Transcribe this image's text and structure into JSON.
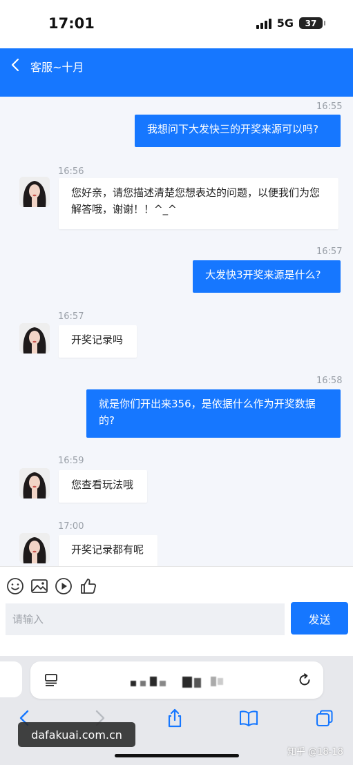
{
  "status": {
    "time": "17:01",
    "network": "5G",
    "battery": "37"
  },
  "header": {
    "title": "客服~十月"
  },
  "messages": [
    {
      "time": "16:55",
      "text": "我想问下大发快三的开奖来源可以吗?"
    },
    {
      "time": "16:56",
      "text": "您好亲，请您描述清楚您想表达的问题，以便我们为您解答哦，谢谢！！^_^"
    },
    {
      "time": "16:57",
      "text": "大发快3开奖来源是什么?"
    },
    {
      "time": "16:57",
      "text": "开奖记录吗"
    },
    {
      "time": "16:58",
      "text": "就是你们开出来356，是依据什么作为开奖数据的?"
    },
    {
      "time": "16:59",
      "text": "您查看玩法哦"
    },
    {
      "time": "17:00",
      "text": "开奖记录都有呢"
    }
  ],
  "toolbar": {
    "icons": [
      "emoji-icon",
      "image-icon",
      "play-icon",
      "thumbs-up-icon"
    ]
  },
  "input": {
    "placeholder": "请输入",
    "send_label": "发送"
  },
  "colors": {
    "accent": "#1677ff",
    "background": "#f4f6fb"
  },
  "watermarks": {
    "left": "dafakuai.com.cn",
    "right": "知乎 @18-18"
  }
}
